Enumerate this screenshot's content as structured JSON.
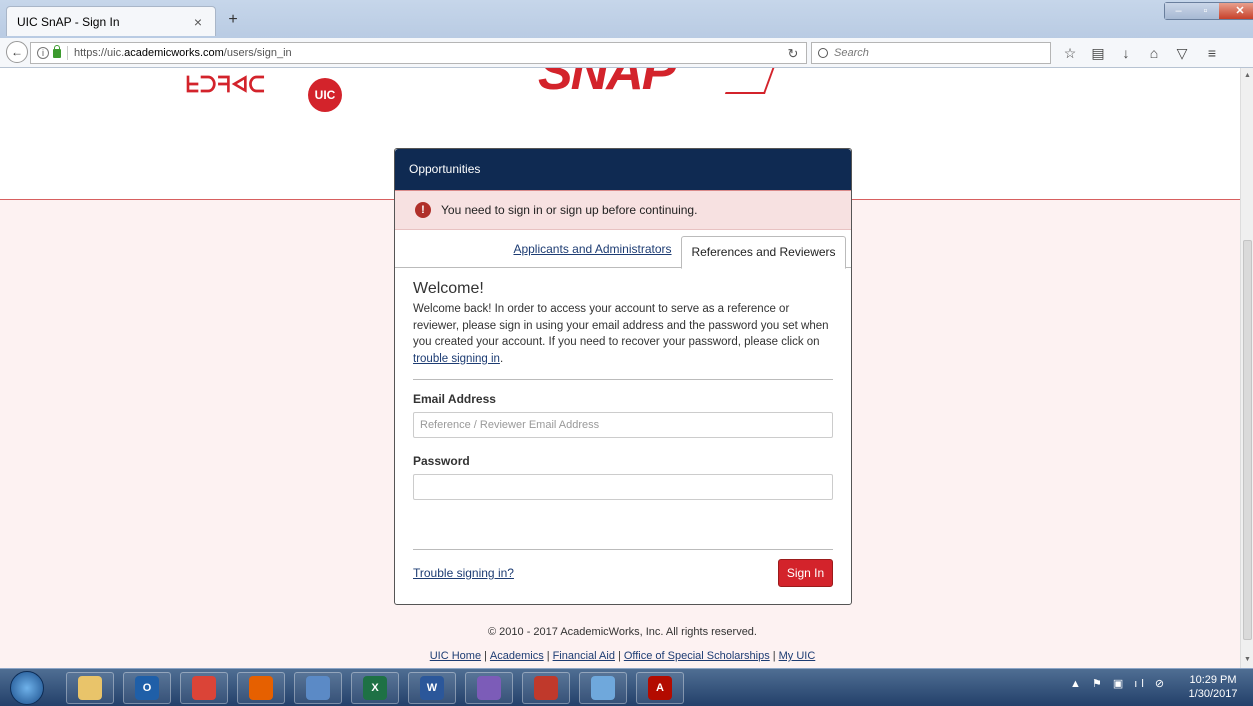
{
  "browser": {
    "tab_title": "UIC SnAP - Sign In",
    "tab_close": "×",
    "new_tab": "+",
    "url_prefix": "https://uic.",
    "url_domain": "academicworks.com",
    "url_path": "/users/sign_in",
    "search_placeholder": "Search",
    "win_minimize": "–",
    "win_maximize": "▫",
    "win_close": "✕"
  },
  "logo": {
    "left_mark": "ᖶᑐᖷᐊᑕ",
    "uic_badge": "UIC",
    "snap_text": "SNAP"
  },
  "panel": {
    "header": "Opportunities",
    "alert_icon": "!",
    "alert": "You need to sign in or sign up before continuing.",
    "tab_applicants": "Applicants and Administrators",
    "tab_references": "References and Reviewers",
    "welcome_title": "Welcome!",
    "welcome_text": "Welcome back! In order to access your account to serve as a reference or reviewer, please sign in using your email address and the password you set when you created your account. If you need to recover your password, please click on ",
    "welcome_link": "trouble signing in",
    "welcome_end": ".",
    "email_label": "Email Address",
    "email_placeholder": "Reference / Reviewer Email Address",
    "password_label": "Password",
    "password_value": "",
    "trouble_link": "Trouble signing in?",
    "signin_button": "Sign In"
  },
  "footer": {
    "copyright": "© 2010 - 2017 AcademicWorks, Inc. All rights reserved.",
    "links": [
      "UIC Home",
      "Academics",
      "Financial Aid",
      "Office of Special Scholarships",
      "My UIC"
    ],
    "separator": "|"
  },
  "taskbar": {
    "apps": [
      {
        "name": "explorer",
        "label": "",
        "color": "#e9c46a"
      },
      {
        "name": "outlook",
        "label": "O",
        "color": "#1f5fa8"
      },
      {
        "name": "chrome",
        "label": "",
        "color": "#db4437"
      },
      {
        "name": "firefox",
        "label": "",
        "color": "#e66000"
      },
      {
        "name": "network",
        "label": "",
        "color": "#5b8ac6"
      },
      {
        "name": "excel",
        "label": "X",
        "color": "#1e7145"
      },
      {
        "name": "word",
        "label": "W",
        "color": "#2b579a"
      },
      {
        "name": "app-bird",
        "label": "",
        "color": "#7c5cb8"
      },
      {
        "name": "app-plane",
        "label": "",
        "color": "#c0392b"
      },
      {
        "name": "app-tile",
        "label": "",
        "color": "#6fa8dc"
      },
      {
        "name": "acrobat",
        "label": "A",
        "color": "#b30b00"
      }
    ],
    "tray": "▲ ⚑ ▣ ıl ⊘",
    "time": "10:29 PM",
    "date": "1/30/2017"
  }
}
